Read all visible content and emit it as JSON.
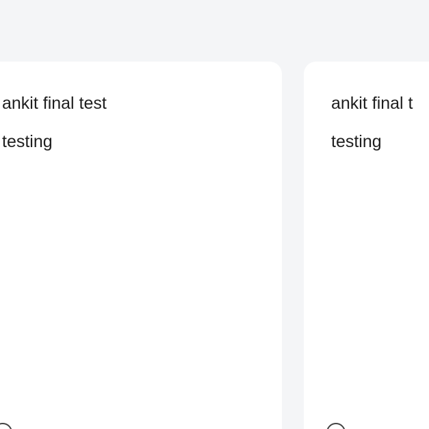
{
  "cards": [
    {
      "title": "ankit final test",
      "subtitle": "testing",
      "icon": "partial-circle-icon"
    },
    {
      "title": "ankit final t",
      "subtitle": "testing",
      "icon": "partial-circle-icon"
    }
  ],
  "colors": {
    "background": "#f4f5f7",
    "card": "#ffffff",
    "text": "#1f1f1f",
    "icon_stroke": "#444444"
  }
}
